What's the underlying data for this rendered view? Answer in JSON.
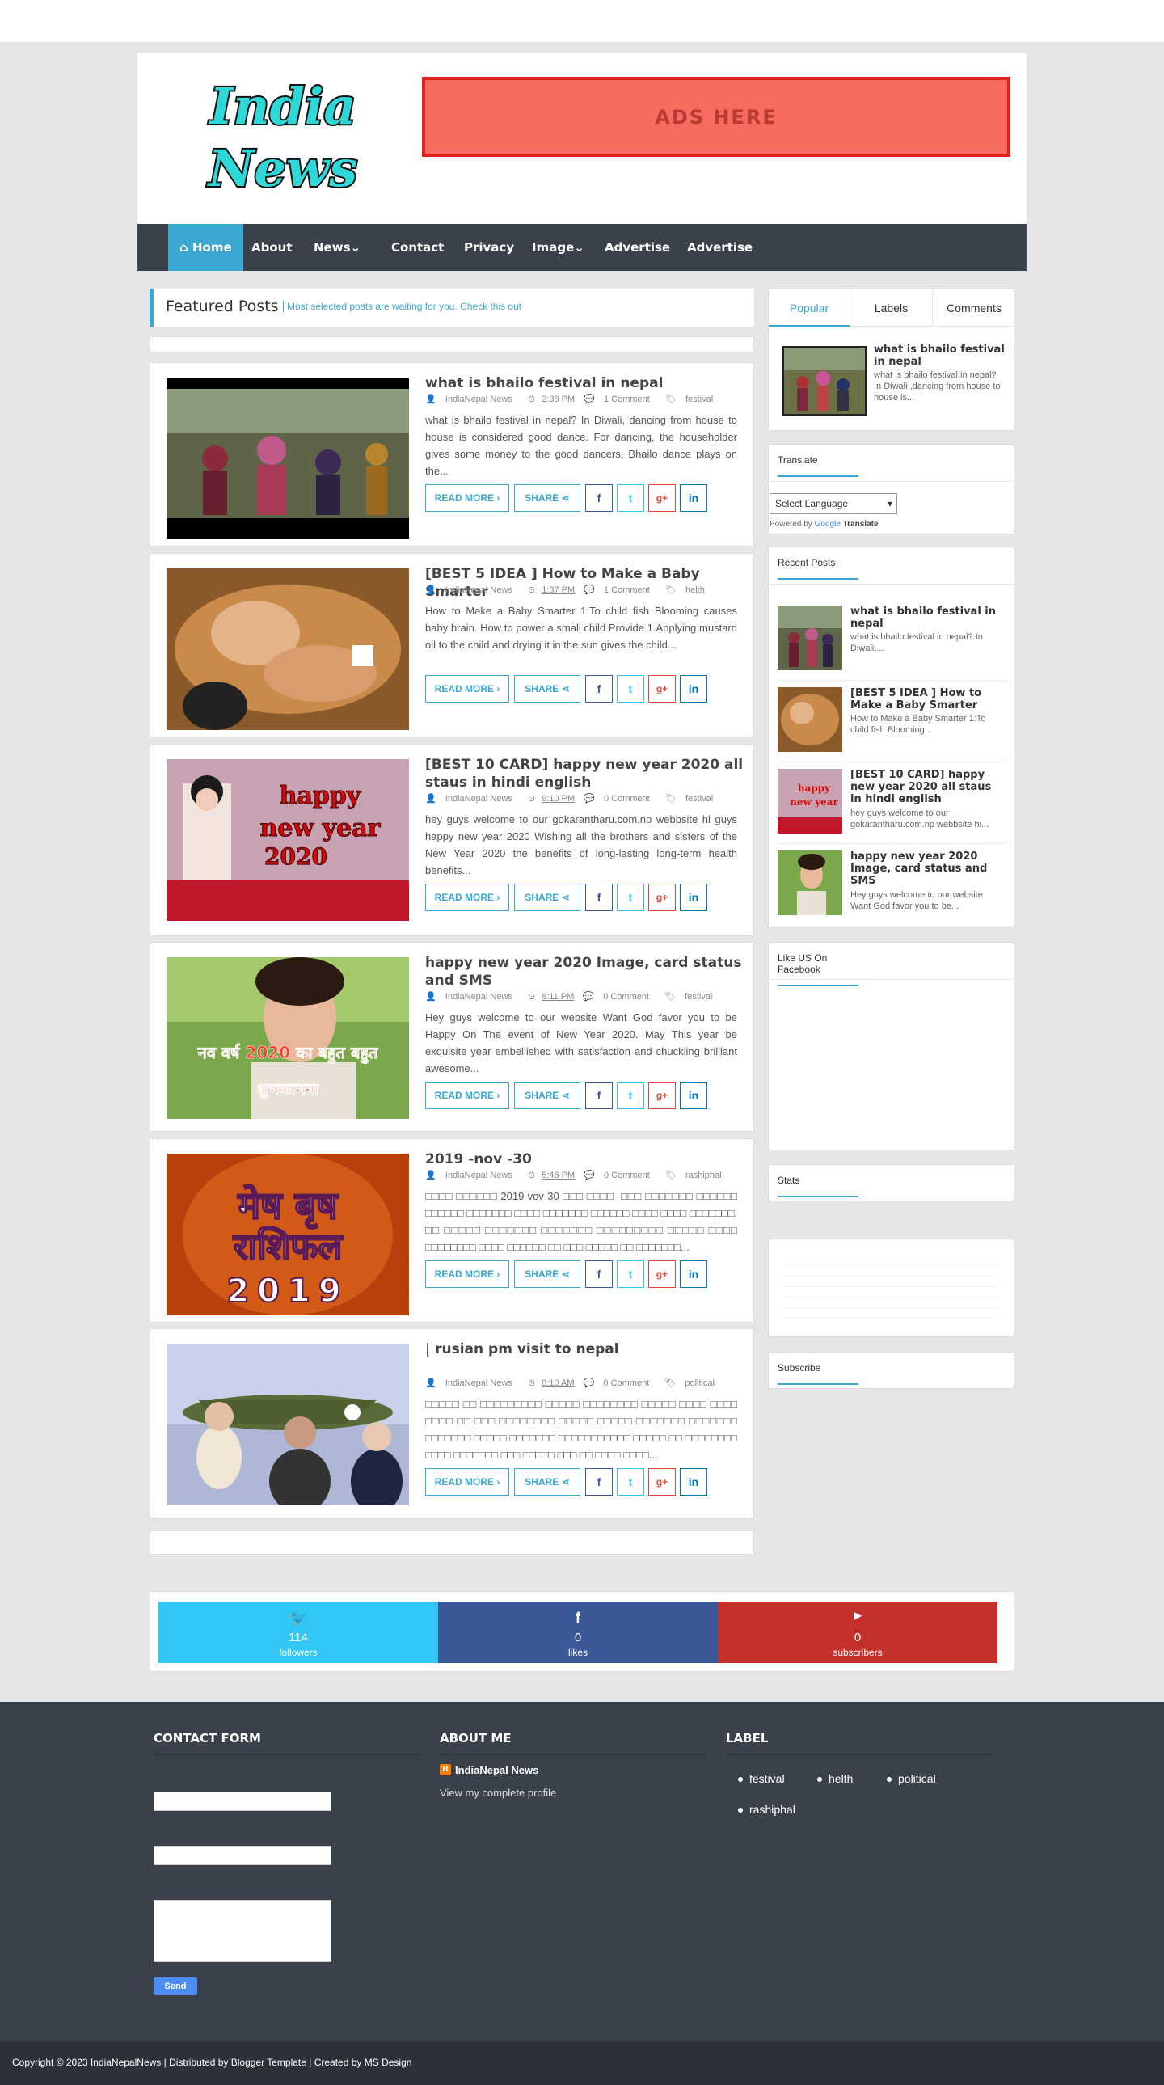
{
  "ad_text": "ADS HERE",
  "logo_line1": "India",
  "logo_line2": "News",
  "nav": [
    "Home",
    "About",
    "News",
    "Contact",
    "Privacy",
    "Image",
    "Advertise",
    "Advertise"
  ],
  "featured": {
    "title": "Featured Posts",
    "subtitle": "Most selected posts are waiting for you. Check this out"
  },
  "posts": [
    {
      "title": "what is bhailo festival in nepal",
      "author": "IndiaNepal News",
      "time": "2:38 PM",
      "comments": "1 Comment",
      "label": "festival",
      "excerpt": "what is bhailo festival  in nepal? In Diwali, dancing from house to house is considered good dance. For dancing, the householder gives some money to the good dancers. Bhailo dance plays on the..."
    },
    {
      "title": "[BEST 5 IDEA ] How to Make a Baby Smarter",
      "author": "IndiaNepal News",
      "time": "1:37 PM",
      "comments": "1 Comment",
      "label": "helth",
      "excerpt": "How to Make a Baby Smarter 1:To child fish Blooming causes baby brain.  How to power a small child Provide 1.Applying mustard oil to the child and drying it in the sun gives the child..."
    },
    {
      "title": "[BEST 10 CARD] happy new year 2020 all staus in hindi english",
      "author": "IndiaNepal News",
      "time": "9:10 PM",
      "comments": "0 Comment",
      "label": "festival",
      "excerpt": "hey guys welcome to our gokarantharu.com.np webbsite hi guys happy new year 2020  Wishing all the brothers and sisters of the New Year 2020 the benefits of long-lasting long-term health benefits..."
    },
    {
      "title": "happy new year 2020 Image, card status and SMS",
      "author": "IndiaNepal News",
      "time": "8:11 PM",
      "comments": "0 Comment",
      "label": "festival",
      "excerpt": "Hey guys welcome to our website Want God favor you to be Happy On The event of New Year 2020. May This year be exquisite year embellished with satisfaction and chuckling brilliant awesome..."
    },
    {
      "title": "2019 -nov -30",
      "author": "IndiaNepal News",
      "time": "5:46 PM",
      "comments": "0 Comment",
      "label": "rashiphal",
      "excerpt": "□□□□ □□□□□□ 2019-vov-30 □□□ □□□□-  □□□ □□□□□□□ □□□□□□ □□□□□□ □□□□□□□ □□□□ □□□□□□□ □□□□□□ □□□□ □□□□ □□□□□□□, □□ □□□□□ □□□□□□□ □□□□□□□ □□□□□□□□□ □□□□□ □□□□ □□□□□□□□ □□□□ □□□□□□ □□ □□□ □□□□□ □□ □□□□□□□..."
    },
    {
      "title": "| rusian pm visit to nepal",
      "author": "IndiaNepal News",
      "time": "8:10 AM",
      "comments": "0 Comment",
      "label": "political",
      "excerpt": "□□□□□ □□ □□□□□□□□□ □□□□□ □□□□□□□□ □□□□□ □□□□ □□□□ □□□□ □□ □□□ □□□□□□□□ □□□□□ □□□□□ □□□□□□□ □□□□□□□ □□□□□□□ □□□□□ □□□□□□□ □□□□□□□□□□□ □□□□□ □□ □□□□□□□□ □□□□ □□□□□□□ □□□ □□□□□ □□□ □□ □□□□ □□□□..."
    }
  ],
  "buttons": {
    "read_more": "READ MORE",
    "share": "SHARE"
  },
  "tabs": [
    "Popular",
    "Labels",
    "Comments"
  ],
  "popular": {
    "title": "what is bhailo festival in nepal",
    "excerpt": "what is bhailo festival  in nepal? In Diwali ,dancing from house to house is..."
  },
  "translate": {
    "title": "Translate",
    "select": "Select Language",
    "powered": "Powered by",
    "google": "Google",
    "translate": "Translate"
  },
  "recent": {
    "title": "Recent Posts",
    "items": [
      {
        "title": "what is bhailo festival in nepal",
        "excerpt": "what is bhailo festival  in nepal? In Diwali,..."
      },
      {
        "title": "[BEST 5 IDEA ] How to Make a Baby Smarter",
        "excerpt": "How to Make a Baby Smarter 1:To child fish Blooming..."
      },
      {
        "title": "[BEST 10 CARD] happy new year 2020 all staus in hindi english",
        "excerpt": "hey guys welcome to our gokarantharu.com.np webbsite hi..."
      },
      {
        "title": "happy new year 2020 Image, card status and SMS",
        "excerpt": "Hey guys welcome to our website Want God favor you to be..."
      }
    ]
  },
  "widgets": {
    "facebook": "Like US On Facebook",
    "stats": "Stats",
    "subscribe": "Subscribe"
  },
  "social": [
    {
      "count": "114",
      "label": "followers",
      "color": "#31c6f4"
    },
    {
      "count": "0",
      "label": "likes",
      "color": "#3b5998"
    },
    {
      "count": "0",
      "label": "subscribers",
      "color": "#c4302b"
    }
  ],
  "footer": {
    "contact_title": "CONTACT FORM",
    "about_title": "ABOUT ME",
    "label_title": "LABEL",
    "about_name": "IndiaNepal News",
    "profile_link": "View my complete profile",
    "send": "Send",
    "labels": [
      "festival",
      "helth",
      "political",
      "rashiphal"
    ],
    "copyright": "Copyright © 2023 IndiaNepalNews | Distributed by Blogger Template | Created by MS Design"
  }
}
